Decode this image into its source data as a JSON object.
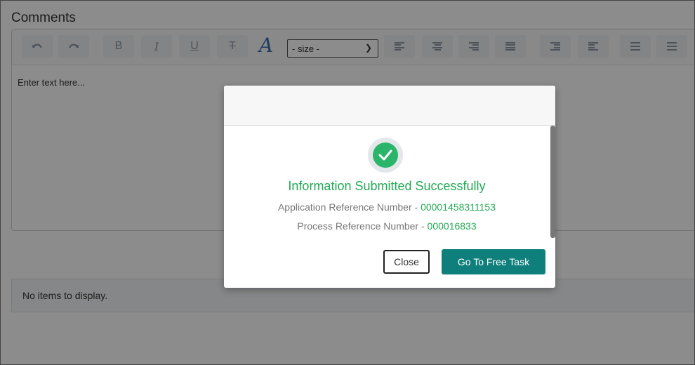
{
  "page": {
    "title": "Comments",
    "editor": {
      "placeholder": "Enter text here...",
      "size_select": "- size -",
      "toolbar_icons": [
        "undo-icon",
        "redo-icon",
        "bold-icon",
        "italic-icon",
        "underline-icon",
        "strikethrough-icon",
        "font-color-icon",
        "align-left-icon",
        "align-center-icon",
        "align-right-icon",
        "align-justify-icon",
        "outdent-icon",
        "indent-icon",
        "bullet-list-icon",
        "numbered-list-icon"
      ]
    },
    "grid_empty": "No items to display."
  },
  "modal": {
    "message": "Information Submitted Successfully",
    "app_ref_label": "Application Reference Number - ",
    "app_ref_value": "00001458311153",
    "proc_ref_label": "Process Reference Number - ",
    "proc_ref_value": "000016833",
    "close_label": "Close",
    "free_task_label": "Go To Free Task"
  },
  "colors": {
    "success": "#22aa55",
    "button_primary": "#0f7f7c",
    "toolbar_icon": "#8a97a6"
  }
}
